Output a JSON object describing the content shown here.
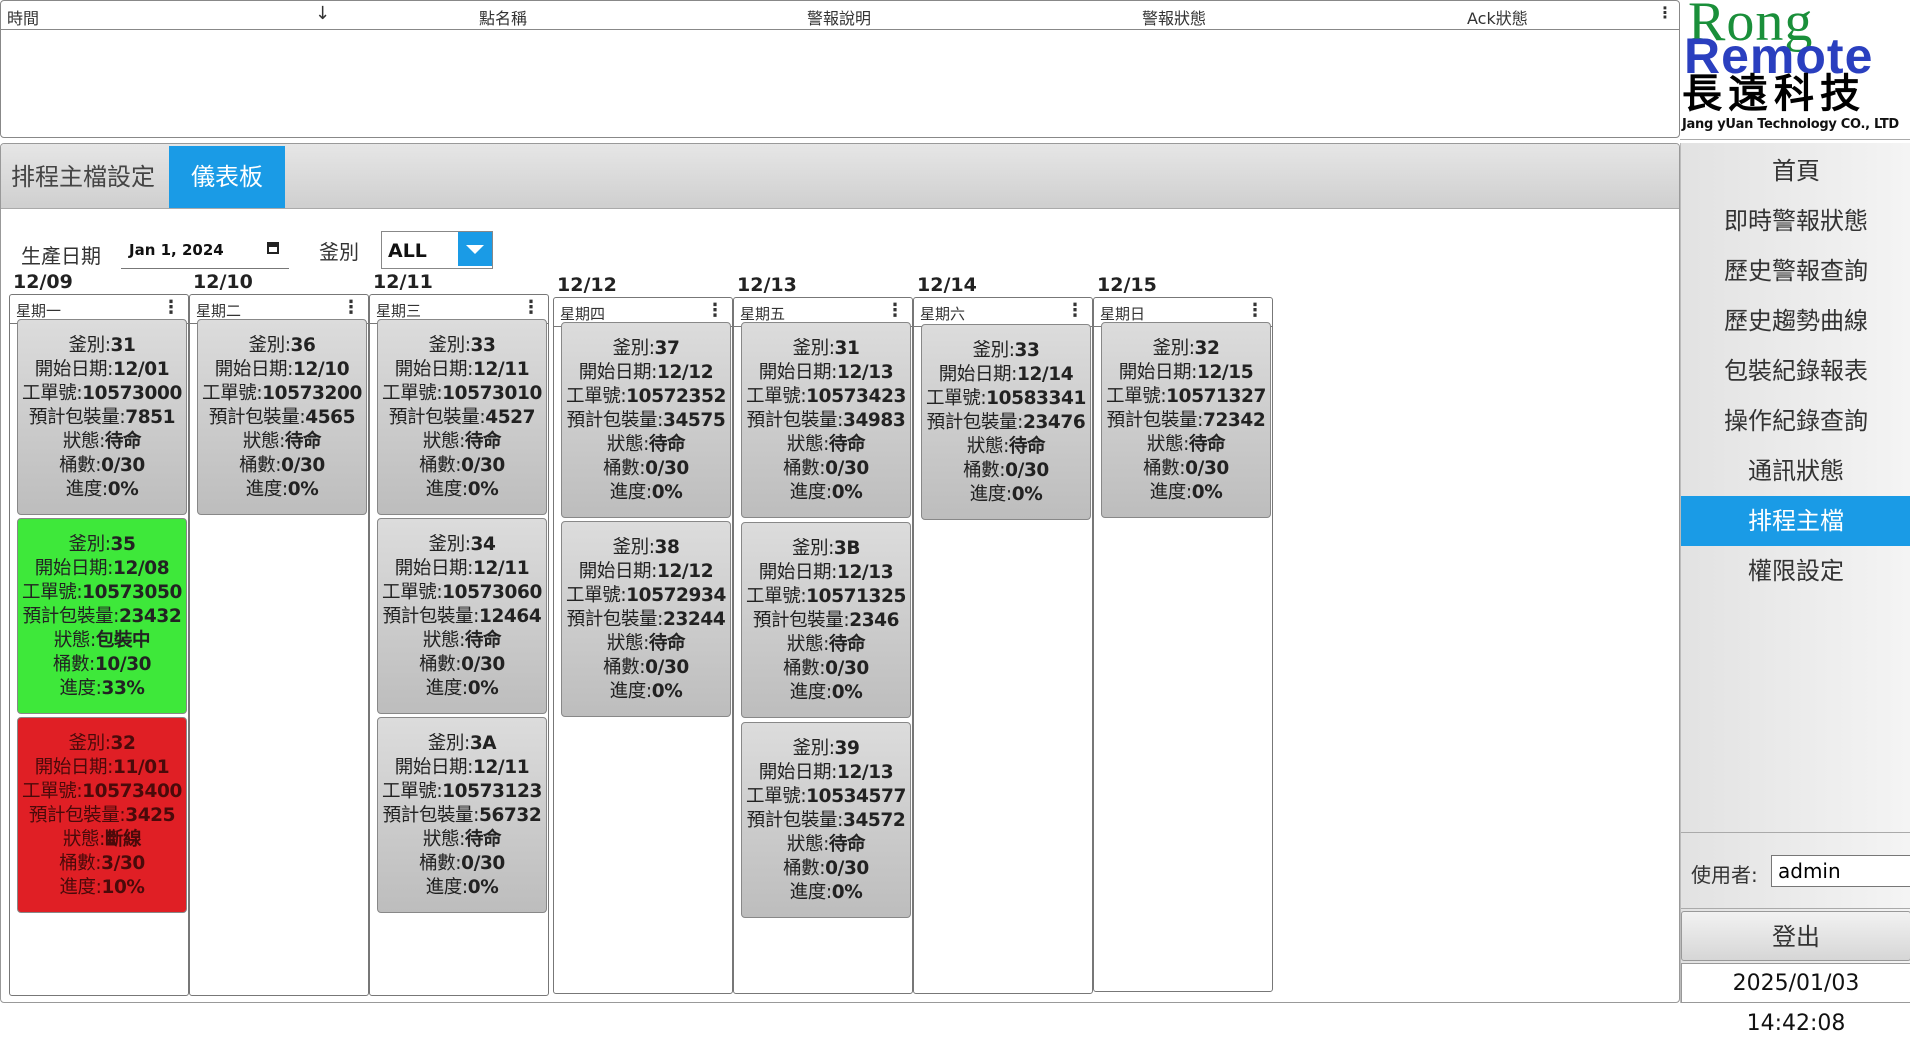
{
  "alarm_table": {
    "headers": [
      "時間",
      "點名稱",
      "警報說明",
      "警報狀態",
      "Ack狀態"
    ]
  },
  "logo": {
    "line1": "Rong",
    "line2": "Remote",
    "chinese": "長遠科技",
    "english": "Jang yUan Technology CO., LTD"
  },
  "tabs": [
    {
      "label": "排程主檔設定"
    },
    {
      "label": "儀表板"
    }
  ],
  "filter": {
    "date_label": "生產日期",
    "date_value": "Jan 1, 2024",
    "kettle_label": "釜別",
    "kettle_value": "ALL"
  },
  "days": [
    {
      "date": "12/09",
      "weekday": "星期一",
      "cards": [
        {
          "status": "gray",
          "kettle": "釜別:31",
          "start": "開始日期:12/01",
          "order": "工單號:10573000",
          "qty": "預計包裝量:7851",
          "state": "狀態:待命",
          "barrels": "桶數:0/30",
          "progress": "進度:0%"
        },
        {
          "status": "green",
          "kettle": "釜別:35",
          "start": "開始日期:12/08",
          "order": "工單號:10573050",
          "qty": "預計包裝量:23432",
          "state": "狀態:包裝中",
          "barrels": "桶數:10/30",
          "progress": "進度:33%"
        },
        {
          "status": "red",
          "kettle": "釜別:32",
          "start": "開始日期:11/01",
          "order": "工單號:10573400",
          "qty": "預計包裝量:3425",
          "state": "狀態:斷線",
          "barrels": "桶數:3/30",
          "progress": "進度:10%"
        }
      ]
    },
    {
      "date": "12/10",
      "weekday": "星期二",
      "cards": [
        {
          "status": "gray",
          "kettle": "釜別:36",
          "start": "開始日期:12/10",
          "order": "工單號:10573200",
          "qty": "預計包裝量:4565",
          "state": "狀態:待命",
          "barrels": "桶數:0/30",
          "progress": "進度:0%"
        }
      ]
    },
    {
      "date": "12/11",
      "weekday": "星期三",
      "cards": [
        {
          "status": "gray",
          "kettle": "釜別:33",
          "start": "開始日期:12/11",
          "order": "工單號:10573010",
          "qty": "預計包裝量:4527",
          "state": "狀態:待命",
          "barrels": "桶數:0/30",
          "progress": "進度:0%"
        },
        {
          "status": "gray",
          "kettle": "釜別:34",
          "start": "開始日期:12/11",
          "order": "工單號:10573060",
          "qty": "預計包裝量:12464",
          "state": "狀態:待命",
          "barrels": "桶數:0/30",
          "progress": "進度:0%"
        },
        {
          "status": "gray",
          "kettle": "釜別:3A",
          "start": "開始日期:12/11",
          "order": "工單號:10573123",
          "qty": "預計包裝量:56732",
          "state": "狀態:待命",
          "barrels": "桶數:0/30",
          "progress": "進度:0%"
        }
      ]
    },
    {
      "date": "12/12",
      "weekday": "星期四",
      "cards": [
        {
          "status": "gray",
          "kettle": "釜別:37",
          "start": "開始日期:12/12",
          "order": "工單號:10572352",
          "qty": "預計包裝量:34575",
          "state": "狀態:待命",
          "barrels": "桶數:0/30",
          "progress": "進度:0%"
        },
        {
          "status": "gray",
          "kettle": "釜別:38",
          "start": "開始日期:12/12",
          "order": "工單號:10572934",
          "qty": "預計包裝量:23244",
          "state": "狀態:待命",
          "barrels": "桶數:0/30",
          "progress": "進度:0%"
        }
      ]
    },
    {
      "date": "12/13",
      "weekday": "星期五",
      "cards": [
        {
          "status": "gray",
          "kettle": "釜別:31",
          "start": "開始日期:12/13",
          "order": "工單號:10573423",
          "qty": "預計包裝量:34983",
          "state": "狀態:待命",
          "barrels": "桶數:0/30",
          "progress": "進度:0%"
        },
        {
          "status": "gray",
          "kettle": "釜別:3B",
          "start": "開始日期:12/13",
          "order": "工單號:10571325",
          "qty": "預計包裝量:2346",
          "state": "狀態:待命",
          "barrels": "桶數:0/30",
          "progress": "進度:0%"
        },
        {
          "status": "gray",
          "kettle": "釜別:39",
          "start": "開始日期:12/13",
          "order": "工單號:10534577",
          "qty": "預計包裝量:34572",
          "state": "狀態:待命",
          "barrels": "桶數:0/30",
          "progress": "進度:0%"
        }
      ]
    },
    {
      "date": "12/14",
      "weekday": "星期六",
      "cards": [
        {
          "status": "gray",
          "kettle": "釜別:33",
          "start": "開始日期:12/14",
          "order": "工單號:10583341",
          "qty": "預計包裝量:23476",
          "state": "狀態:待命",
          "barrels": "桶數:0/30",
          "progress": "進度:0%"
        }
      ]
    },
    {
      "date": "12/15",
      "weekday": "星期日",
      "cards": [
        {
          "status": "gray",
          "kettle": "釜別:32",
          "start": "開始日期:12/15",
          "order": "工單號:10571327",
          "qty": "預計包裝量:72342",
          "state": "狀態:待命",
          "barrels": "桶數:0/30",
          "progress": "進度:0%"
        }
      ]
    }
  ],
  "sidebar": {
    "items": [
      {
        "label": "首頁"
      },
      {
        "label": "即時警報狀態"
      },
      {
        "label": "歷史警報查詢"
      },
      {
        "label": "歷史趨勢曲線"
      },
      {
        "label": "包裝紀錄報表"
      },
      {
        "label": "操作紀錄查詢"
      },
      {
        "label": "通訊狀態"
      },
      {
        "label": "排程主檔",
        "active": true
      },
      {
        "label": "權限設定"
      }
    ],
    "user_label": "使用者:",
    "user_value": "admin",
    "logout_label": "登出",
    "clock": "2025/01/03 14:42:08"
  },
  "colors": {
    "accent": "#1a9be6",
    "card_running": "#3ee83a",
    "card_offline": "#e01f25",
    "card_idle": "#c8c8c8"
  },
  "icons": [
    "sort-down-arrow-icon",
    "kebab-menu-icon",
    "calendar-icon",
    "chevron-down-icon"
  ]
}
